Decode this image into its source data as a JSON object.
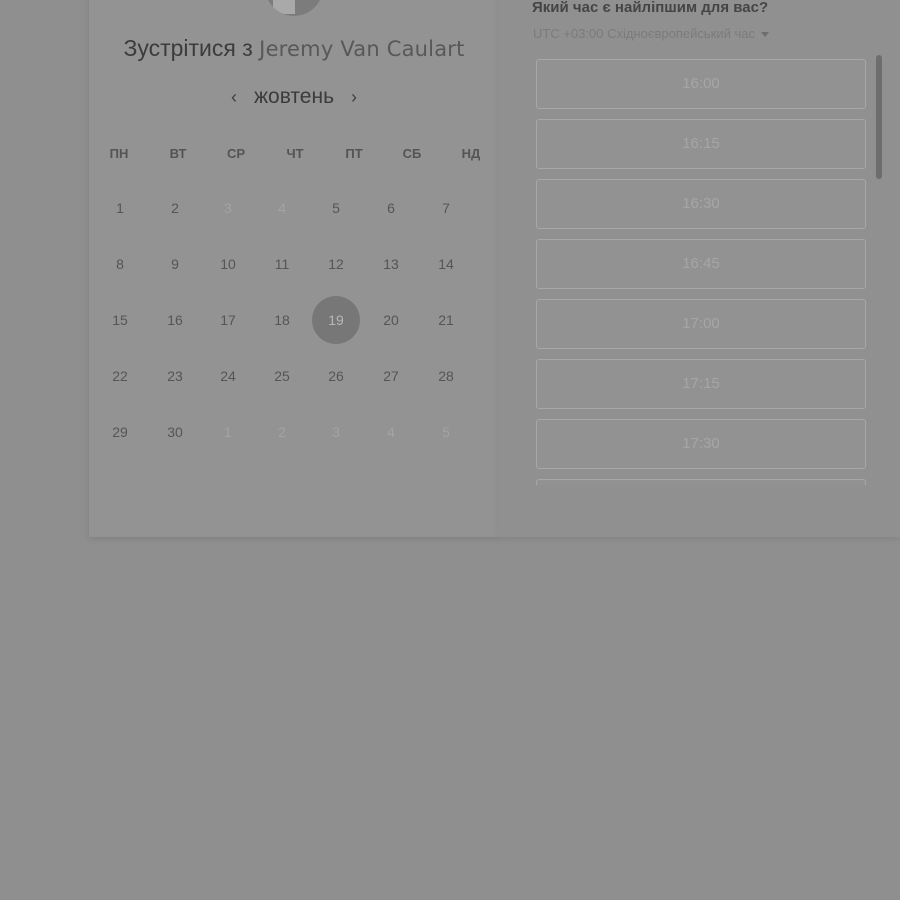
{
  "booking": {
    "title_prefix": "Зустрітися з",
    "host_name": "Jeremy Van Caulart"
  },
  "calendar": {
    "month": "жовтень",
    "prev_icon": "chevron-left-icon",
    "next_icon": "chevron-right-icon",
    "weekdays": [
      "ПН",
      "ВТ",
      "СР",
      "ЧТ",
      "ПТ",
      "СБ",
      "НД"
    ],
    "weeks": [
      [
        {
          "d": "1"
        },
        {
          "d": "2"
        },
        {
          "d": "3",
          "dim": true
        },
        {
          "d": "4",
          "dim": true
        },
        {
          "d": "5"
        },
        {
          "d": "6"
        },
        {
          "d": "7"
        }
      ],
      [
        {
          "d": "8"
        },
        {
          "d": "9"
        },
        {
          "d": "10"
        },
        {
          "d": "11"
        },
        {
          "d": "12"
        },
        {
          "d": "13"
        },
        {
          "d": "14"
        }
      ],
      [
        {
          "d": "15"
        },
        {
          "d": "16"
        },
        {
          "d": "17"
        },
        {
          "d": "18"
        },
        {
          "d": "19",
          "selected": true
        },
        {
          "d": "20"
        },
        {
          "d": "21"
        }
      ],
      [
        {
          "d": "22"
        },
        {
          "d": "23"
        },
        {
          "d": "24"
        },
        {
          "d": "25"
        },
        {
          "d": "26"
        },
        {
          "d": "27"
        },
        {
          "d": "28"
        }
      ],
      [
        {
          "d": "29"
        },
        {
          "d": "30"
        },
        {
          "d": "1",
          "dim": true
        },
        {
          "d": "2",
          "dim": true
        },
        {
          "d": "3",
          "dim": true
        },
        {
          "d": "4",
          "dim": true
        },
        {
          "d": "5",
          "dim": true
        }
      ]
    ]
  },
  "times": {
    "question": "Який час є найліпшим для вас?",
    "timezone": "UTC +03:00 Східноєвропейський час",
    "slots": [
      "16:00",
      "16:15",
      "16:30",
      "16:45",
      "17:00",
      "17:15",
      "17:30",
      ""
    ]
  }
}
